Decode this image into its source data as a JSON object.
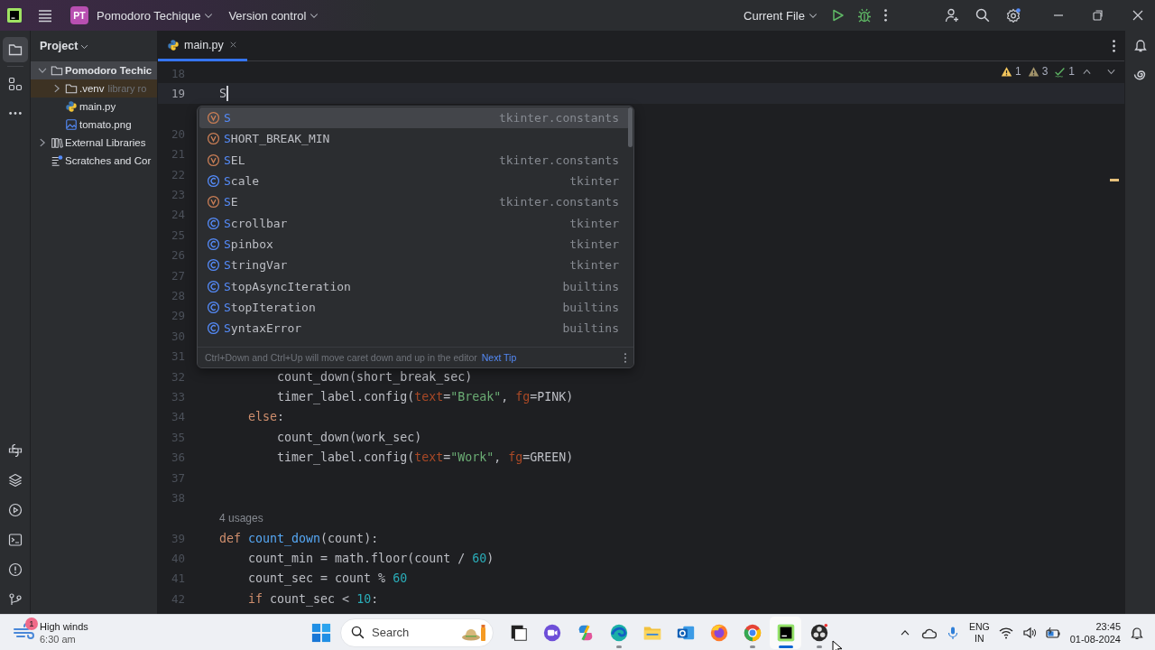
{
  "title_bar": {
    "project_badge": "PT",
    "project": "Pomodoro Techique",
    "vcs": "Version control",
    "run_config": "Current File"
  },
  "left_tools": [
    {
      "selected": true
    },
    {
      "selected": false
    },
    {
      "selected": false
    }
  ],
  "project_panel": {
    "title": "Project",
    "tree": [
      {
        "label": "Pomodoro Techic",
        "kind": "folder",
        "expanded": true,
        "selected": true,
        "highlighted": false,
        "children": [
          {
            "label": ".venv",
            "hint": "library ro",
            "kind": "folder",
            "expanded": false,
            "selected": false,
            "highlighted": true
          },
          {
            "label": "main.py",
            "kind": "python",
            "selected": false,
            "highlighted": false
          },
          {
            "label": "tomato.png",
            "kind": "image",
            "selected": false,
            "highlighted": false
          }
        ]
      },
      {
        "label": "External Libraries",
        "kind": "library",
        "expanded": false,
        "selected": false,
        "highlighted": false
      },
      {
        "label": "Scratches and Cor",
        "kind": "scratch",
        "selected": false,
        "highlighted": false
      }
    ]
  },
  "editor": {
    "tabs": [
      {
        "label": "main.py",
        "selected": true
      }
    ],
    "inspections": [
      {
        "kind": "warning",
        "count": "1"
      },
      {
        "kind": "weak_warning",
        "count": "3"
      },
      {
        "kind": "typo",
        "count": "1"
      }
    ],
    "lines": [
      {
        "kind": "code",
        "number": "18",
        "current": false
      },
      {
        "kind": "code",
        "number": "19",
        "current": true,
        "caret": true
      },
      {
        "kind": "blank"
      },
      {
        "kind": "code",
        "number": "20",
        "current": false
      },
      {
        "kind": "code",
        "number": "21",
        "current": false
      },
      {
        "kind": "code",
        "number": "22",
        "current": false
      },
      {
        "kind": "code",
        "number": "23",
        "current": false
      },
      {
        "kind": "code",
        "number": "24",
        "current": false
      },
      {
        "kind": "code",
        "number": "25",
        "current": false
      },
      {
        "kind": "code",
        "number": "26",
        "current": false
      },
      {
        "kind": "code",
        "number": "27",
        "current": false
      },
      {
        "kind": "code",
        "number": "28",
        "current": false
      },
      {
        "kind": "code",
        "number": "29",
        "current": false
      },
      {
        "kind": "code",
        "number": "30",
        "current": false
      },
      {
        "kind": "code",
        "number": "31",
        "current": false
      },
      {
        "kind": "code",
        "number": "32",
        "current": false,
        "tokens": [
          {
            "kind": "plain",
            "s": "        count_down(short_break_sec)"
          }
        ]
      },
      {
        "kind": "code",
        "number": "33",
        "current": false,
        "tokens": [
          {
            "kind": "plain",
            "s": "        timer_label.config("
          },
          {
            "kind": "param",
            "s": "text"
          },
          {
            "kind": "plain",
            "s": "="
          },
          {
            "kind": "string",
            "s": "\"Break\""
          },
          {
            "kind": "plain",
            "s": ", "
          },
          {
            "kind": "param",
            "s": "fg"
          },
          {
            "kind": "plain",
            "s": "=PINK)"
          }
        ]
      },
      {
        "kind": "code",
        "number": "34",
        "current": false,
        "tokens": [
          {
            "kind": "keyword",
            "s": "    else"
          },
          {
            "kind": "plain",
            "s": ":"
          }
        ]
      },
      {
        "kind": "code",
        "number": "35",
        "current": false,
        "tokens": [
          {
            "kind": "plain",
            "s": "        count_down(work_sec)"
          }
        ]
      },
      {
        "kind": "code",
        "number": "36",
        "current": false,
        "tokens": [
          {
            "kind": "plain",
            "s": "        timer_label.config("
          },
          {
            "kind": "param",
            "s": "text"
          },
          {
            "kind": "plain",
            "s": "="
          },
          {
            "kind": "string",
            "s": "\"Work\""
          },
          {
            "kind": "plain",
            "s": ", "
          },
          {
            "kind": "param",
            "s": "fg"
          },
          {
            "kind": "plain",
            "s": "=GREEN)"
          }
        ]
      },
      {
        "kind": "code",
        "number": "37",
        "current": false
      },
      {
        "kind": "code",
        "number": "38",
        "current": false
      },
      {
        "kind": "hint",
        "text": "4 usages"
      },
      {
        "kind": "code",
        "number": "39",
        "current": false,
        "tokens": [
          {
            "kind": "keyword",
            "s": "def "
          },
          {
            "kind": "func",
            "s": "count_down"
          },
          {
            "kind": "plain",
            "s": "(count):"
          }
        ]
      },
      {
        "kind": "code",
        "number": "40",
        "current": false,
        "tokens": [
          {
            "kind": "plain",
            "s": "    count_min = math.floor(count / "
          },
          {
            "kind": "number",
            "s": "60"
          },
          {
            "kind": "plain",
            "s": ")"
          }
        ]
      },
      {
        "kind": "code",
        "number": "41",
        "current": false,
        "tokens": [
          {
            "kind": "plain",
            "s": "    count_sec = count % "
          },
          {
            "kind": "number",
            "s": "60"
          }
        ]
      },
      {
        "kind": "code",
        "number": "42",
        "current": false,
        "tokens": [
          {
            "kind": "keyword",
            "s": "    if"
          },
          {
            "kind": "plain",
            "s": " count_sec < "
          },
          {
            "kind": "number",
            "s": "10"
          },
          {
            "kind": "plain",
            "s": ":"
          }
        ]
      }
    ],
    "completion": {
      "typed": "S",
      "items": [
        {
          "kind": "variable",
          "label": "S",
          "source": "tkinter.constants",
          "selected": true
        },
        {
          "kind": "variable",
          "label": "SHORT_BREAK_MIN",
          "selected": false
        },
        {
          "kind": "variable",
          "label": "SEL",
          "source": "tkinter.constants",
          "selected": false
        },
        {
          "kind": "class",
          "label": "Scale",
          "source": "tkinter",
          "selected": false
        },
        {
          "kind": "variable",
          "label": "SE",
          "source": "tkinter.constants",
          "selected": false
        },
        {
          "kind": "class",
          "label": "Scrollbar",
          "source": "tkinter",
          "selected": false
        },
        {
          "kind": "class",
          "label": "Spinbox",
          "source": "tkinter",
          "selected": false
        },
        {
          "kind": "class",
          "label": "StringVar",
          "source": "tkinter",
          "selected": false
        },
        {
          "kind": "class",
          "label": "StopAsyncIteration",
          "source": "builtins",
          "selected": false
        },
        {
          "kind": "class",
          "label": "StopIteration",
          "source": "builtins",
          "selected": false
        },
        {
          "kind": "class",
          "label": "SyntaxError",
          "source": "builtins",
          "selected": false
        }
      ],
      "tip": "Ctrl+Down and Ctrl+Up will move caret down and up in the editor",
      "tip_link": "Next Tip"
    }
  },
  "taskbar": {
    "weather": {
      "badge": "1",
      "title": "High winds",
      "time": "6:30 am"
    },
    "search": {
      "placeholder": "Search"
    },
    "apps": [
      {
        "running": false,
        "active": false
      },
      {
        "running": false,
        "active": false
      },
      {
        "running": false,
        "active": false
      },
      {
        "running": true,
        "active": false
      },
      {
        "running": false,
        "active": false
      },
      {
        "running": false,
        "active": false
      },
      {
        "running": false,
        "active": false
      },
      {
        "running": true,
        "active": false
      },
      {
        "running": true,
        "active": true
      },
      {
        "running": true,
        "active": false
      }
    ],
    "tray": {
      "language": "ENG",
      "region": "IN",
      "time": "23:45",
      "date": "01-08-2024"
    }
  }
}
